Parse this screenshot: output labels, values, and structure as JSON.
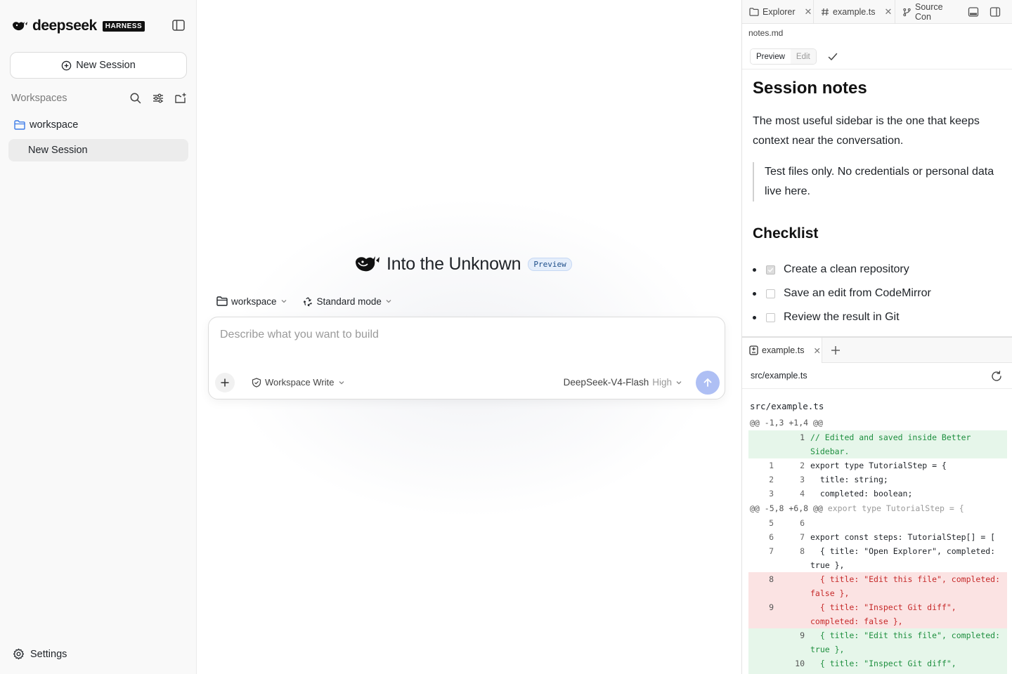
{
  "sidebar": {
    "brand": "deepseek",
    "brand_badge": "HARNESS",
    "new_session_label": "New Session",
    "workspaces_label": "Workspaces",
    "workspace_name": "workspace",
    "session_item": "New Session",
    "settings_label": "Settings"
  },
  "main": {
    "hero_title": "Into the Unknown",
    "hero_badge": "Preview",
    "workspace_selector": "workspace",
    "mode_selector": "Standard mode",
    "prompt_placeholder": "Describe what you want to build",
    "permission": "Workspace Write",
    "model": "DeepSeek-V4-Flash",
    "model_level": "High",
    "accent_color": "#aebff4"
  },
  "right_panel": {
    "tabs": [
      {
        "label": "Explorer",
        "icon": "folder-icon"
      },
      {
        "label": "example.ts",
        "icon": "hash-icon"
      },
      {
        "label": "Source Con",
        "icon": "git-branch-icon"
      }
    ],
    "open_file": "notes.md",
    "view_preview": "Preview",
    "view_edit": "Edit",
    "markdown": {
      "title": "Session notes",
      "paragraph": "The most useful sidebar is the one that keeps context near the conversation.",
      "quote": "Test files only. No credentials or personal data live here.",
      "checklist_heading": "Checklist",
      "checklist": [
        {
          "text": "Create a clean repository",
          "checked": true
        },
        {
          "text": "Save an edit from CodeMirror",
          "checked": false
        },
        {
          "text": "Review the result in Git",
          "checked": false
        }
      ]
    },
    "bottom_tab": "example.ts",
    "diff_path": "src/example.ts",
    "diff": {
      "file": "src/example.ts",
      "hunk1": "@@ -1,3 +1,4 @@",
      "hunk2": "@@ -5,8 +6,8 @@",
      "hunk2_context": "export type TutorialStep = {",
      "lines1": [
        {
          "old": "",
          "new": "1",
          "type": "add",
          "code": "// Edited and saved inside Better Sidebar."
        },
        {
          "old": "1",
          "new": "2",
          "type": "ctx",
          "code": "export type TutorialStep = {"
        },
        {
          "old": "2",
          "new": "3",
          "type": "ctx",
          "code": "  title: string;"
        },
        {
          "old": "3",
          "new": "4",
          "type": "ctx",
          "code": "  completed: boolean;"
        }
      ],
      "lines2": [
        {
          "old": "5",
          "new": "6",
          "type": "ctx",
          "code": ""
        },
        {
          "old": "6",
          "new": "7",
          "type": "ctx",
          "code": "export const steps: TutorialStep[] = ["
        },
        {
          "old": "7",
          "new": "8",
          "type": "ctx",
          "code": "  { title: \"Open Explorer\", completed: true },"
        },
        {
          "old": "8",
          "new": "",
          "type": "del",
          "code": "  { title: \"Edit this file\", completed: false },"
        },
        {
          "old": "9",
          "new": "",
          "type": "del",
          "code": "  { title: \"Inspect Git diff\", completed: false },"
        },
        {
          "old": "",
          "new": "9",
          "type": "add",
          "code": "  { title: \"Edit this file\", completed: true },"
        },
        {
          "old": "",
          "new": "10",
          "type": "add",
          "code": "  { title: \"Inspect Git diff\", completed: true },"
        }
      ]
    }
  }
}
